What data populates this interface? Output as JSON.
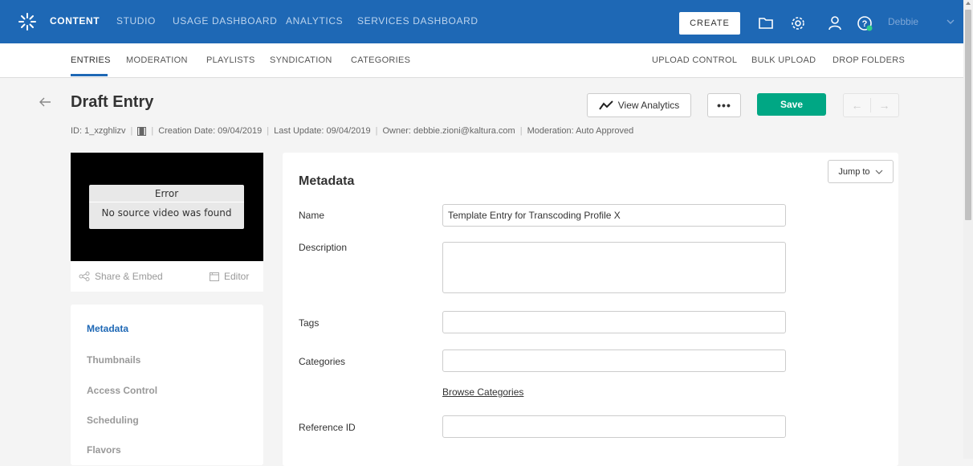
{
  "topnav": {
    "items": [
      "CONTENT",
      "STUDIO",
      "USAGE DASHBOARD",
      "ANALYTICS",
      "SERVICES DASHBOARD"
    ],
    "create_label": "CREATE",
    "user_name": "Debbie"
  },
  "subnav": {
    "left": [
      "ENTRIES",
      "MODERATION",
      "PLAYLISTS",
      "SYNDICATION",
      "CATEGORIES"
    ],
    "right": [
      "UPLOAD CONTROL",
      "BULK UPLOAD",
      "DROP FOLDERS"
    ]
  },
  "entry": {
    "title": "Draft Entry",
    "analytics_label": "View Analytics",
    "more_label": "•••",
    "save_label": "Save",
    "prev_label": "←",
    "next_label": "→",
    "meta": {
      "id": "ID: 1_xzghlizv",
      "creation": "Creation Date: 09/04/2019",
      "update": "Last Update: 09/04/2019",
      "owner": "Owner: debbie.zioni@kaltura.com",
      "moderation": "Moderation: Auto Approved"
    }
  },
  "player": {
    "error_title": "Error",
    "error_message": "No source video was found",
    "share_label": "Share & Embed",
    "editor_label": "Editor"
  },
  "sidebar": {
    "items": [
      "Metadata",
      "Thumbnails",
      "Access Control",
      "Scheduling",
      "Flavors"
    ]
  },
  "metadata": {
    "title": "Metadata",
    "jump_label": "Jump to",
    "name_label": "Name",
    "name_value": "Template Entry for Transcoding Profile X",
    "description_label": "Description",
    "description_value": "",
    "tags_label": "Tags",
    "tags_value": "",
    "categories_label": "Categories",
    "categories_value": "",
    "browse_label": "Browse Categories",
    "reference_label": "Reference ID",
    "reference_value": ""
  },
  "colors": {
    "nav_bg": "#1e68b5",
    "save_green": "#00a784",
    "active_link": "#1e68b5"
  }
}
